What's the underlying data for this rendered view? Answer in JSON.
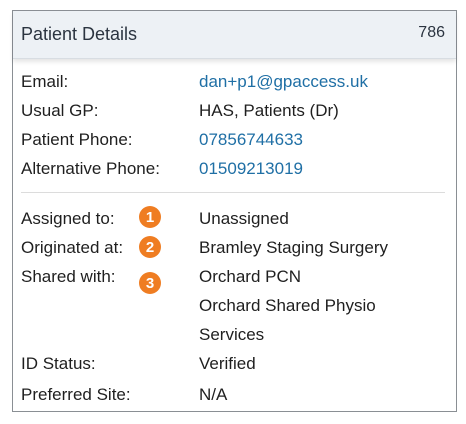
{
  "panel": {
    "title": "Patient Details",
    "count": "786"
  },
  "contact": [
    {
      "label": "Email:",
      "value": "dan+p1@gpaccess.uk"
    },
    {
      "label": "Usual GP:",
      "value": "HAS, Patients (Dr)"
    },
    {
      "label": "Patient Phone:",
      "value": "07856744633"
    },
    {
      "label": "Alternative Phone:",
      "value": "01509213019"
    }
  ],
  "details": [
    {
      "label": "Assigned to:",
      "badge": "1",
      "value": "Unassigned"
    },
    {
      "label": "Originated at:",
      "badge": "2",
      "value": "Bramley Staging Surgery"
    },
    {
      "label": "Shared with:",
      "badge": "3",
      "values": [
        "Orchard PCN",
        "Orchard Shared Physio",
        "Services"
      ]
    },
    {
      "label": "ID Status:",
      "value": "Verified"
    },
    {
      "label": "Preferred Site:",
      "value": "N/A"
    }
  ],
  "colors": {
    "badge": "#ef7d22",
    "link": "#1f6fa5",
    "header_bg": "#edf1f5"
  }
}
